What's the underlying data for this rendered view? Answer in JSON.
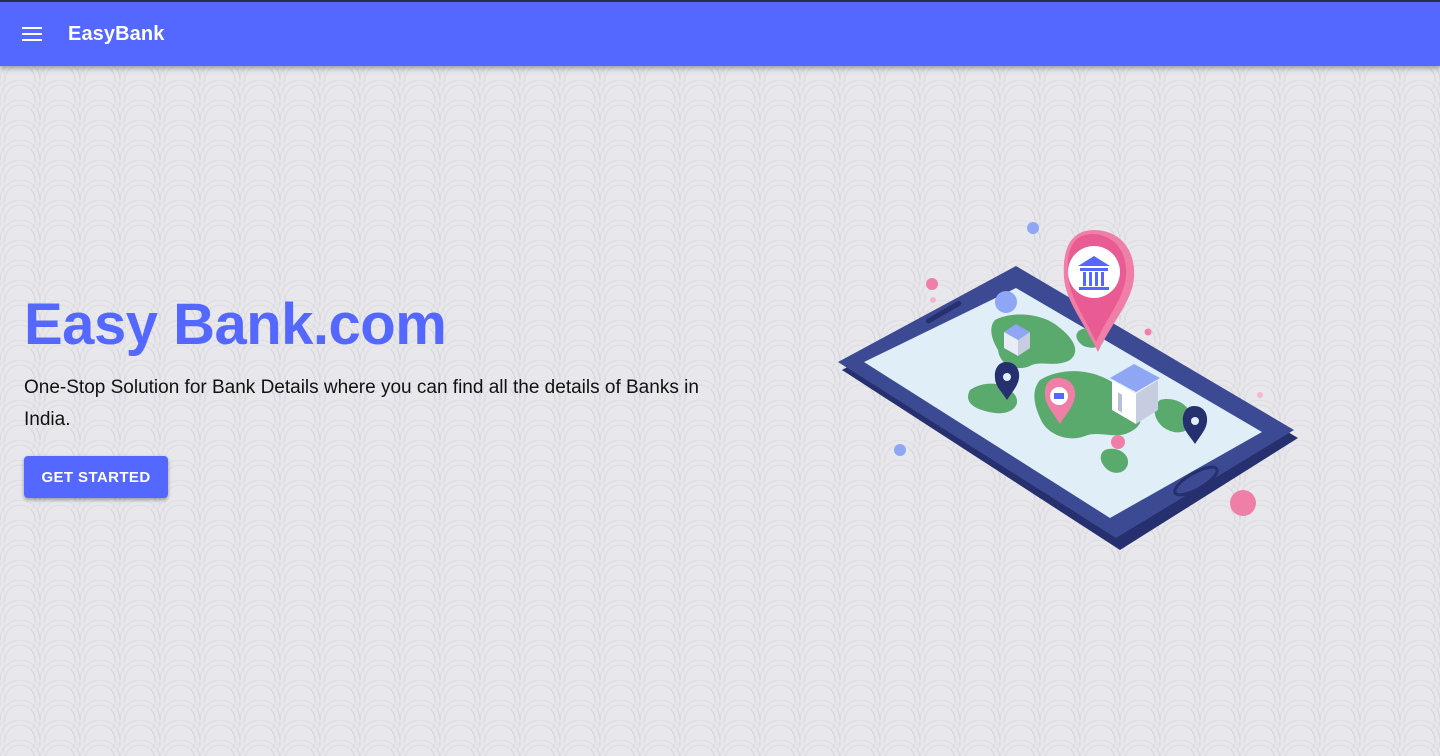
{
  "appbar": {
    "menu_icon": "hamburger-menu-icon",
    "brand": "EasyBank",
    "color": "#5468ff"
  },
  "hero": {
    "title": "Easy Bank.com",
    "subtitle": "One-Stop Solution for Bank Details where you can find all the details of Banks in India.",
    "cta_label": "GET STARTED",
    "accent_color": "#5468ff"
  },
  "illustration": {
    "icon": "phone-map-bank-location-illustration"
  }
}
